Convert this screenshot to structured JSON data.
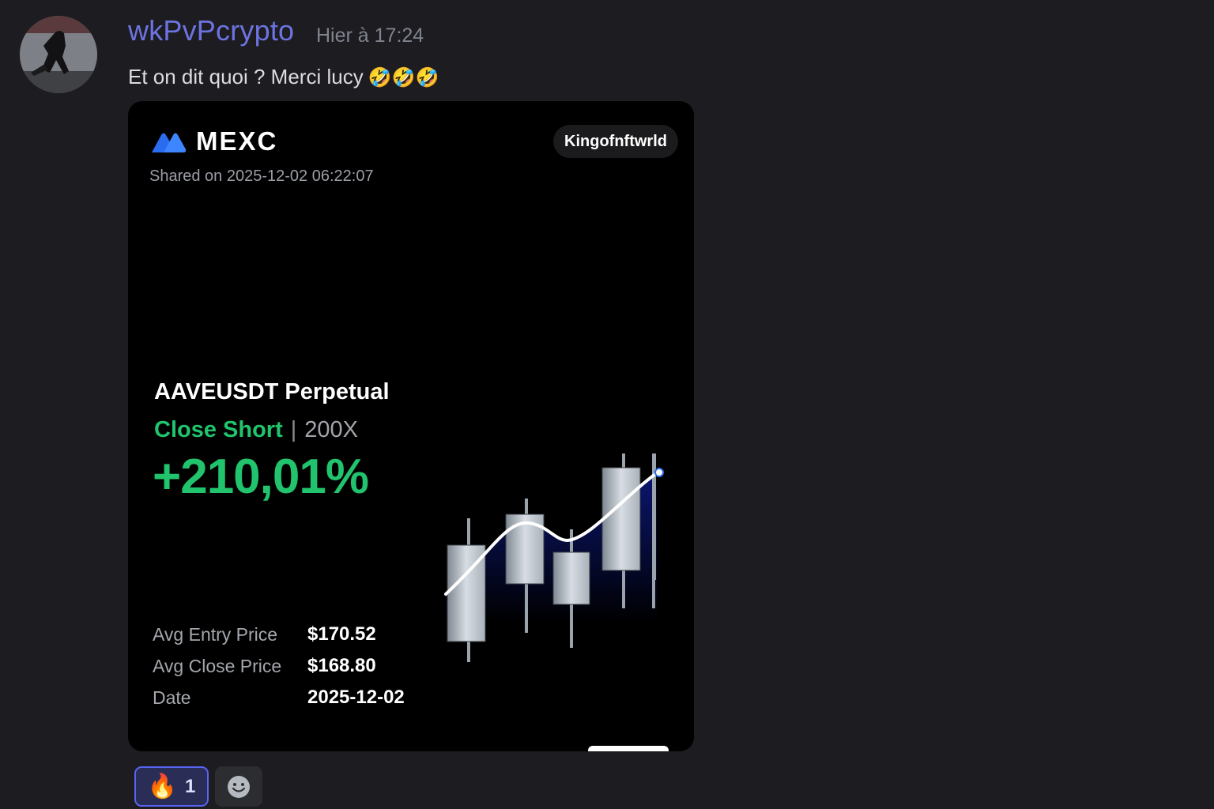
{
  "message": {
    "author": "wkPvPcrypto",
    "timestamp": "Hier à 17:24",
    "text": "Et on dit quoi ? Merci lucy",
    "emojis": "🤣🤣🤣"
  },
  "card": {
    "brand": "MEXC",
    "username": "Kingofnftwrld",
    "shared_on": "Shared on 2025-12-02 06:22:07",
    "pair": "AAVEUSDT Perpetual",
    "side": "Close Short",
    "separator": "|",
    "leverage": "200X",
    "roi": "+210,01%",
    "details": [
      {
        "label": "Avg Entry Price",
        "value": "$170.52"
      },
      {
        "label": "Avg Close Price",
        "value": "$168.80"
      },
      {
        "label": "Date",
        "value": "2025-12-02"
      }
    ],
    "colors": {
      "profit": "#21c46c",
      "brand_blue": "#2a6cf0",
      "area_fill": "#0b1670"
    }
  },
  "reactions": [
    {
      "emoji": "🔥",
      "count": "1",
      "active": true
    },
    {
      "icon": "add-reaction-icon"
    }
  ],
  "colors": {
    "background": "#1c1c21",
    "author": "#6d73e0",
    "accent": "#5865f2"
  }
}
